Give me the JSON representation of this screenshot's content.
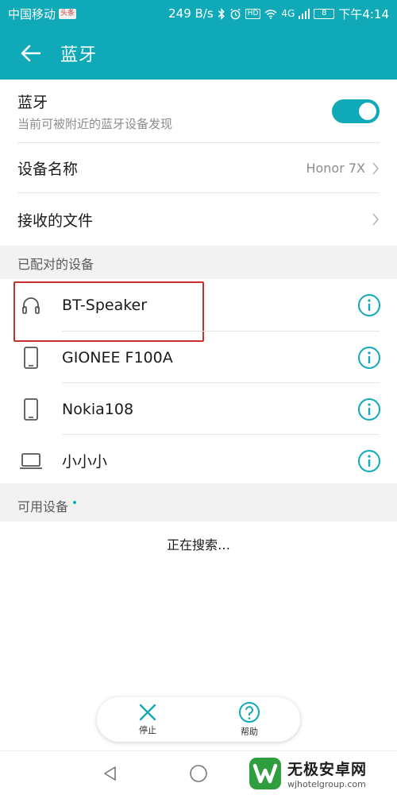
{
  "status": {
    "carrier": "中国移动",
    "badge": "头条",
    "speed": "249 B/s",
    "hd": "HD",
    "net": "4G",
    "battery": "8",
    "time": "下午4:14"
  },
  "header": {
    "title": "蓝牙"
  },
  "bluetooth": {
    "label": "蓝牙",
    "subtitle": "当前可被附近的蓝牙设备发现",
    "enabled": true
  },
  "device_name": {
    "label": "设备名称",
    "value": "Honor 7X"
  },
  "received_files": {
    "label": "接收的文件"
  },
  "paired_section": {
    "title": "已配对的设备"
  },
  "paired_devices": [
    {
      "name": "BT-Speaker",
      "icon": "headphones-icon"
    },
    {
      "name": "GIONEE F100A",
      "icon": "phone-icon"
    },
    {
      "name": "Nokia108",
      "icon": "phone-icon"
    },
    {
      "name": "小小小",
      "icon": "laptop-icon"
    }
  ],
  "available_section": {
    "title": "可用设备"
  },
  "searching_text": "正在搜索…",
  "actions": {
    "stop": "停止",
    "help": "帮助"
  },
  "colors": {
    "accent": "#10a9b8",
    "highlight": "#c9302c"
  },
  "watermark": {
    "brand": "无极安卓网",
    "url": "wjhotelgroup.com"
  }
}
